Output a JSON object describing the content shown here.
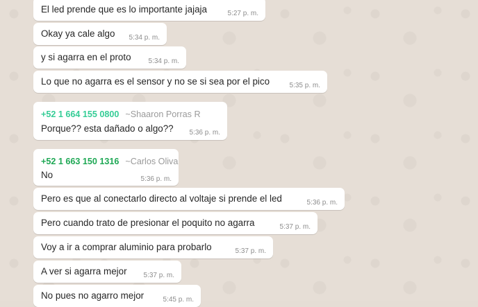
{
  "messages": [
    {
      "text": "El led prende que es lo importante jajaja",
      "time": "5:27 p. m."
    },
    {
      "text": "Okay ya cale algo",
      "time": "5:34 p. m."
    },
    {
      "text": "y si agarra en el proto",
      "time": "5:34 p. m."
    },
    {
      "text": "Lo que no agarra es el sensor y no se si sea por el pico",
      "time": "5:35 p. m."
    },
    {
      "sender_phone": "+52 1 664 155 0800",
      "sender_name": "~Shaaron Porras R",
      "sender_color": "#35cd96",
      "text": "Porque?? esta dañado o algo??",
      "time": "5:36 p. m."
    },
    {
      "sender_phone": "+52 1 663 150 1316",
      "sender_name": "~Carlos Oliva",
      "sender_color": "#1fa855",
      "text": "No",
      "time": "5:36 p. m."
    },
    {
      "text": "Pero es que al conectarlo directo al voltaje si prende el led",
      "time": "5:36 p. m."
    },
    {
      "text": "Pero cuando trato de presionar el poquito no agarra",
      "time": "5:37 p. m."
    },
    {
      "text": "Voy a ir a comprar aluminio para probarlo",
      "time": "5:37 p. m."
    },
    {
      "text": "A ver si agarra mejor",
      "time": "5:37 p. m."
    },
    {
      "text": "No pues no agarro mejor",
      "time": "5:45 p. m."
    }
  ]
}
